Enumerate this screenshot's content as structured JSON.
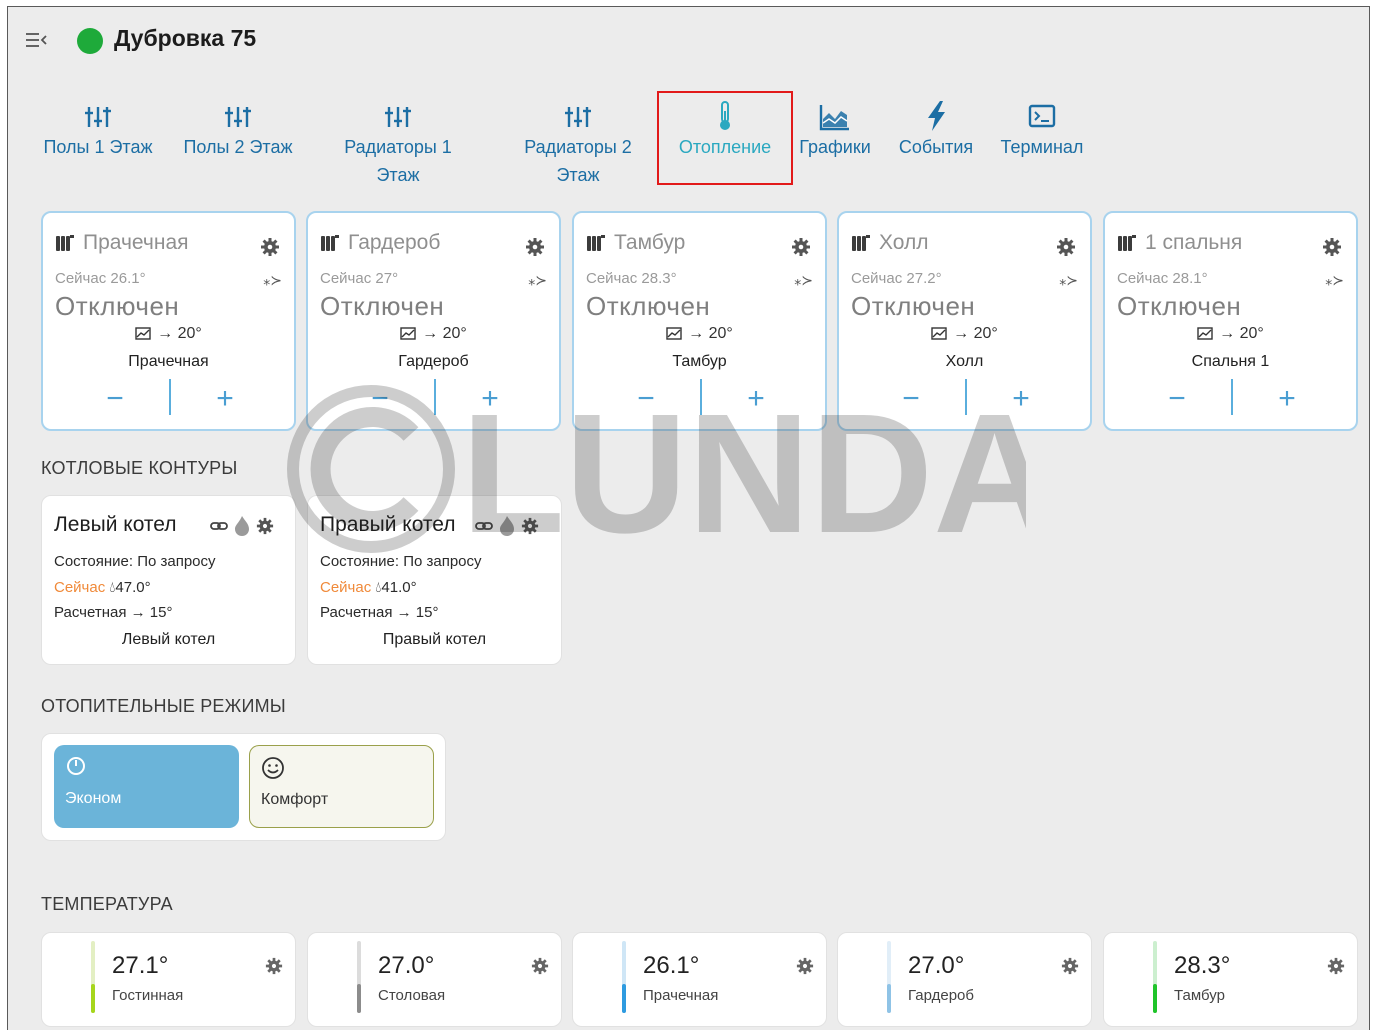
{
  "header": {
    "title": "Дубровка 75",
    "status_color": "#1eaa3a"
  },
  "nav": [
    {
      "label": "Полы 1 Этаж",
      "icon": "sliders-icon"
    },
    {
      "label": "Полы 2 Этаж",
      "icon": "sliders-icon"
    },
    {
      "label": "Радиаторы 1 Этаж",
      "icon": "sliders-icon"
    },
    {
      "label": "Радиаторы 2 Этаж",
      "icon": "sliders-icon"
    },
    {
      "label": "Отопление",
      "icon": "thermometer-icon",
      "active": true
    },
    {
      "label": "Графики",
      "icon": "area-chart-icon"
    },
    {
      "label": "События",
      "icon": "lightning-icon"
    },
    {
      "label": "Терминал",
      "icon": "terminal-icon"
    }
  ],
  "rooms": [
    {
      "title": "Прачечная",
      "now": "Сейчас 26.1°",
      "state": "Отключен",
      "target": "→ 20°",
      "name": "Прачечная"
    },
    {
      "title": "Гардероб",
      "now": "Сейчас 27°",
      "state": "Отключен",
      "target": "→ 20°",
      "name": "Гардероб"
    },
    {
      "title": "Тамбур",
      "now": "Сейчас 28.3°",
      "state": "Отключен",
      "target": "→ 20°",
      "name": "Тамбур"
    },
    {
      "title": "Холл",
      "now": "Сейчас 27.2°",
      "state": "Отключен",
      "target": "→ 20°",
      "name": "Холл"
    },
    {
      "title": "1 спальня",
      "now": "Сейчас 28.1°",
      "state": "Отключен",
      "target": "→ 20°",
      "name": "Спальня 1"
    }
  ],
  "room_controls": {
    "minus": "−",
    "plus": "+"
  },
  "sections": {
    "boilers": "КОТЛОВЫЕ КОНТУРЫ",
    "modes": "ОТОПИТЕЛЬНЫЕ РЕЖИМЫ",
    "temperature": "ТЕМПЕРАТУРА"
  },
  "boilers": [
    {
      "title": "Левый котел",
      "state_label": "Состояние:",
      "state_value": "По запросу",
      "now_label": "Сейчас",
      "now_value": "47.0°",
      "calc_label": "Расчетная",
      "calc_value": "→ 15°",
      "footer": "Левый котел"
    },
    {
      "title": "Правый котел",
      "state_label": "Состояние:",
      "state_value": "По запросу",
      "now_label": "Сейчас",
      "now_value": "41.0°",
      "calc_label": "Расчетная",
      "calc_value": "→ 15°",
      "footer": "Правый котел"
    }
  ],
  "modes": [
    {
      "label": "Эконом",
      "icon": "power-icon",
      "selected": true
    },
    {
      "label": "Комфорт",
      "icon": "smile-icon",
      "selected": false
    }
  ],
  "temperatures": [
    {
      "value": "27.1°",
      "name": "Гостинная",
      "color": "#a6d61c",
      "level": 0.4
    },
    {
      "value": "27.0°",
      "name": "Столовая",
      "color": "#8c8c8c",
      "level": 0.4
    },
    {
      "value": "26.1°",
      "name": "Прачечная",
      "color": "#2e9be0",
      "level": 0.4
    },
    {
      "value": "27.0°",
      "name": "Гардероб",
      "color": "#8fc3e6",
      "level": 0.4
    },
    {
      "value": "28.3°",
      "name": "Тамбур",
      "color": "#1fc42a",
      "level": 0.4
    }
  ],
  "watermark": {
    "text": "LUNDA"
  }
}
